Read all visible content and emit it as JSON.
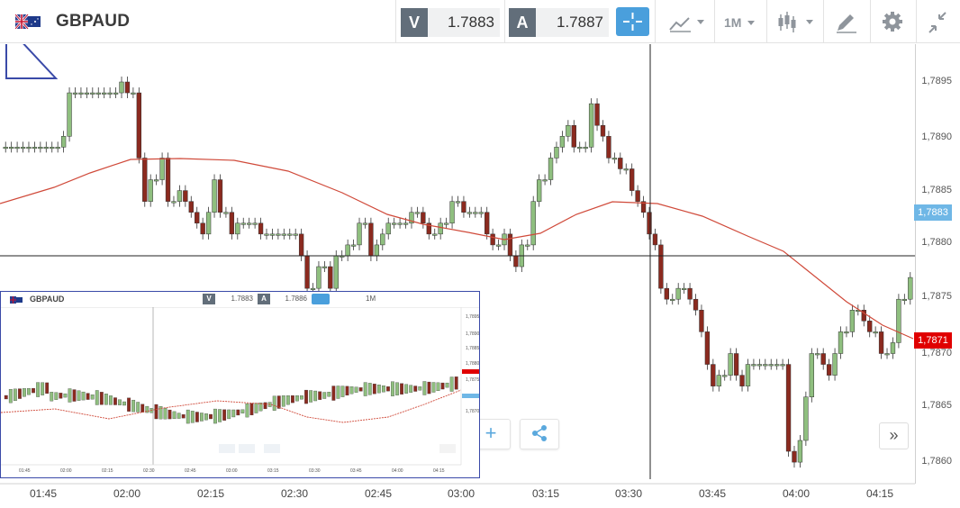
{
  "header": {
    "symbol": "GBPAUD",
    "bid_label": "V",
    "bid_value": "1.7883",
    "ask_label": "A",
    "ask_value": "1.7887",
    "timeframe": "1M",
    "accent_color": "#4a9fdc"
  },
  "chart_data": {
    "type": "candlestick",
    "yticks": [
      "1,7895",
      "1,7890",
      "1,7885",
      "1,7880",
      "1,7875",
      "1,7870",
      "1,7865",
      "1,7860"
    ],
    "xticks": [
      "01:45",
      "02:00",
      "02:15",
      "02:30",
      "02:45",
      "03:00",
      "03:15",
      "03:30",
      "03:45",
      "04:00",
      "04:15"
    ],
    "last_bid_tag": "1,7883",
    "last_red_tag": "1,7871",
    "series_colors": {
      "up": "#8fbf7f",
      "down": "#8b2a1f",
      "ma": "#d04a3a"
    }
  },
  "inset": {
    "symbol": "GBPAUD",
    "bid_label": "V",
    "bid_value": "1.7883",
    "ask_label": "A",
    "ask_value": "1.7886",
    "timeframe": "1M",
    "yticks": [
      "1,7895",
      "1,7890",
      "1,7885",
      "1,7880",
      "1,7875",
      "1,7870"
    ],
    "xticks": [
      "01:45",
      "02:00",
      "02:15",
      "02:30",
      "02:45",
      "03:00",
      "03:15",
      "03:30",
      "03:45",
      "04:00",
      "04:15"
    ]
  },
  "icons": {
    "crosshair": "crosshair-icon",
    "chart_type": "line-chart-icon",
    "candles": "candlestick-icon",
    "draw": "pencil-icon",
    "settings": "gear-icon",
    "collapse": "collapse-icon",
    "add": "plus-icon",
    "share": "share-icon",
    "expand": "double-chevron-right-icon"
  }
}
